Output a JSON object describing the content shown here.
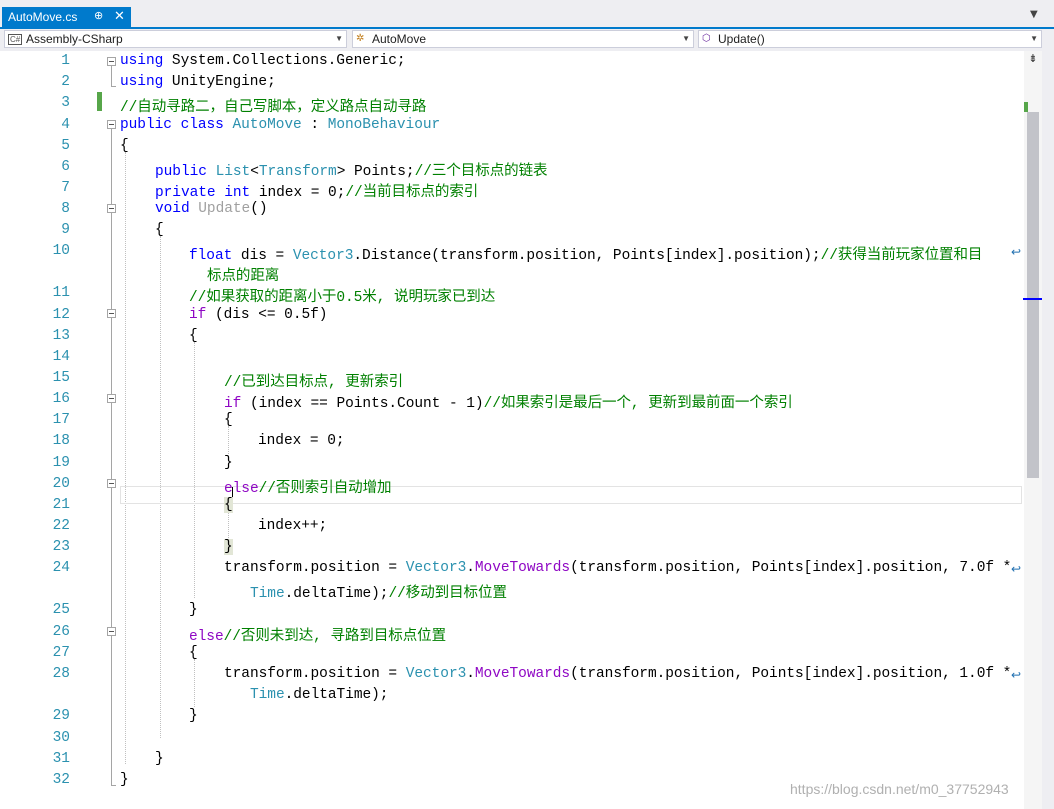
{
  "tab": {
    "title": "AutoMove.cs",
    "pin": "⊕",
    "close": "✕"
  },
  "navbar": {
    "project": "Assembly-CSharp",
    "project_icon": "C#",
    "class": "AutoMove",
    "member": "Update()"
  },
  "editor": {
    "line_numbers": [
      "1",
      "2",
      "3",
      "4",
      "5",
      "6",
      "7",
      "8",
      "9",
      "10",
      "11",
      "12",
      "13",
      "14",
      "15",
      "16",
      "17",
      "18",
      "19",
      "20",
      "21",
      "22",
      "23",
      "24",
      "25",
      "26",
      "27",
      "28",
      "29",
      "30",
      "31",
      "32"
    ]
  },
  "colors": {
    "accent": "#007acc",
    "keyword": "#0000ff",
    "type": "#2b91af",
    "comment": "#008000",
    "control": "#8f08c4"
  },
  "watermark": "https://blog.csdn.net/m0_37752943"
}
